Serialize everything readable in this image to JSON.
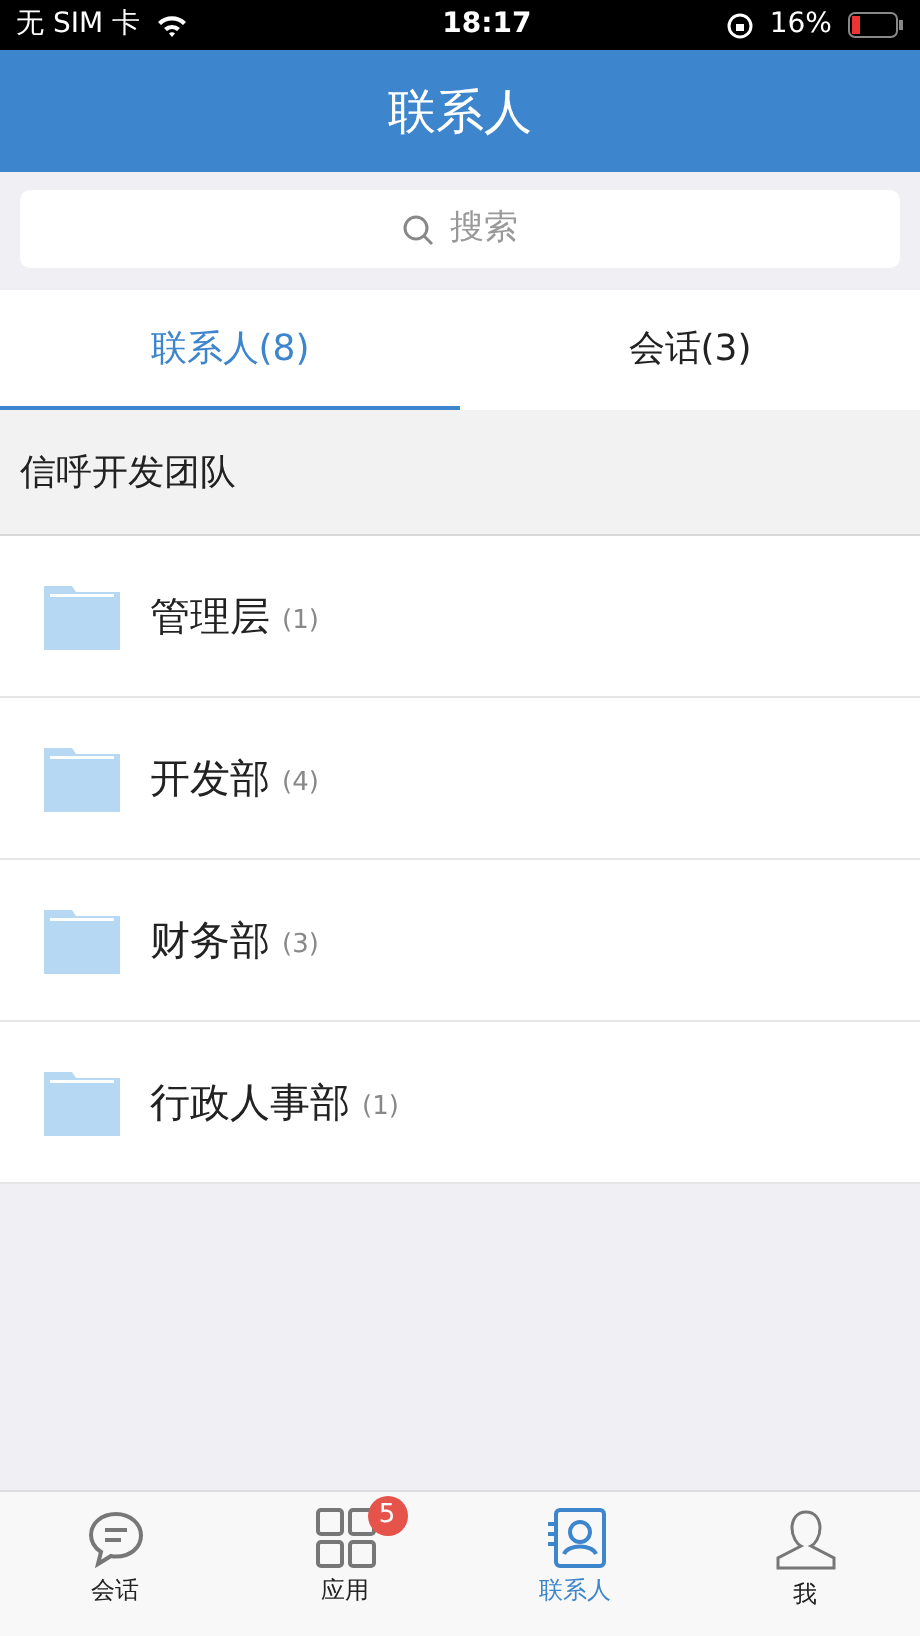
{
  "status_bar": {
    "carrier": "无 SIM 卡",
    "time": "18:17",
    "battery": "16%"
  },
  "header": {
    "title": "联系人"
  },
  "search": {
    "placeholder": "搜索"
  },
  "tabs": [
    {
      "label": "联系人(8)",
      "selected": true
    },
    {
      "label": "会话(3)",
      "selected": false
    }
  ],
  "group": {
    "title": "信呼开发团队"
  },
  "folders": [
    {
      "name": "管理层",
      "count": "(1)"
    },
    {
      "name": "开发部",
      "count": "(4)"
    },
    {
      "name": "财务部",
      "count": "(3)"
    },
    {
      "name": "行政人事部",
      "count": "(1)"
    }
  ],
  "bottom_nav": [
    {
      "kind": "chat",
      "label": "会话",
      "selected": false
    },
    {
      "kind": "apps",
      "label": "应用",
      "badge": "5",
      "selected": false
    },
    {
      "kind": "contacts",
      "label": "联系人",
      "selected": true
    },
    {
      "kind": "me",
      "label": "我",
      "selected": false
    }
  ]
}
